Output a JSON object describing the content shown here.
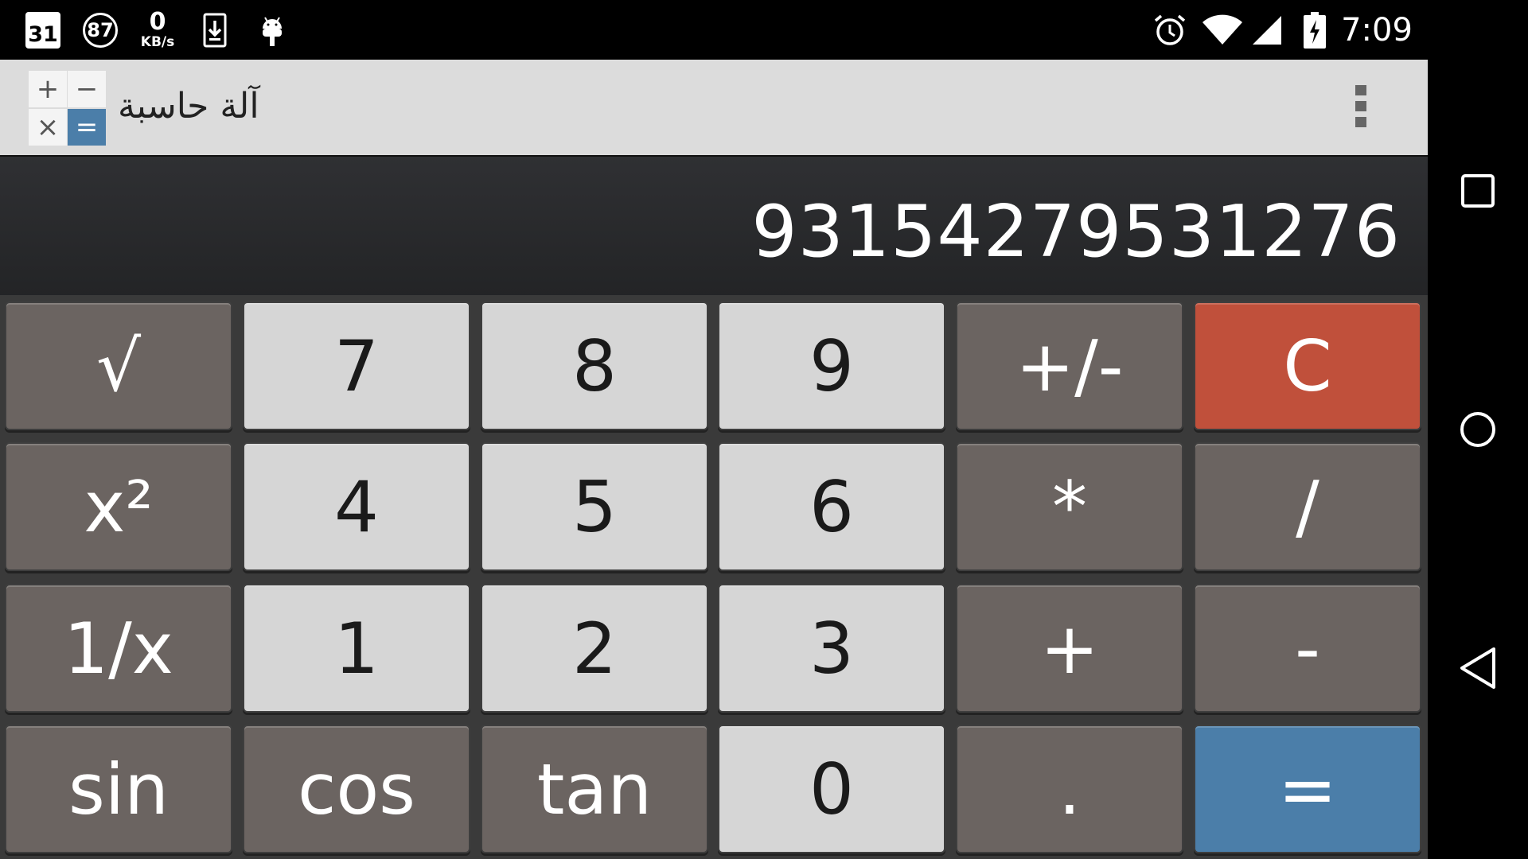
{
  "status_bar": {
    "calendar_day": "31",
    "notification_count": "87",
    "net_speed_value": "0",
    "net_speed_unit": "KB/s",
    "time": "7:09",
    "icons": [
      "calendar-icon",
      "notification-badge-icon",
      "network-speed-icon",
      "download-icon",
      "android-debug-icon",
      "alarm-icon",
      "wifi-icon",
      "cell-signal-icon",
      "battery-charging-icon"
    ]
  },
  "action_bar": {
    "app_icon_symbols": {
      "plus": "+",
      "minus": "−",
      "times": "×",
      "equals": "="
    },
    "title": "آلة حاسبة",
    "overflow_icon": "overflow-menu-icon"
  },
  "display": {
    "value": "93154279531276"
  },
  "keys": {
    "sqrt": "√",
    "seven": "7",
    "eight": "8",
    "nine": "9",
    "plus_minus": "+/-",
    "clear": "C",
    "square": "x²",
    "four": "4",
    "five": "5",
    "six": "6",
    "multiply": "*",
    "divide": "/",
    "reciprocal": "1/x",
    "one": "1",
    "two": "2",
    "three": "3",
    "add": "+",
    "subtract": "-",
    "sin": "sin",
    "cos": "cos",
    "tan": "tan",
    "zero": "0",
    "decimal": ".",
    "equals": "="
  },
  "colors": {
    "number_key": "#d6d6d6",
    "function_key": "#6b6461",
    "clear_key": "#c0503b",
    "equals_key": "#4b7ea9",
    "action_bar": "#dcdcdc",
    "display": "#2a2b2d"
  },
  "nav_bar": {
    "icons": [
      "recent-apps-icon",
      "home-icon",
      "back-icon"
    ]
  }
}
